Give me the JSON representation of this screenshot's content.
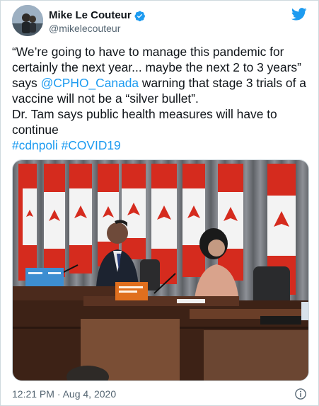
{
  "author": {
    "display_name": "Mike Le Couteur",
    "handle": "@mikelecouteur"
  },
  "tweet": {
    "line1": "“We’re going to have to manage this pandemic for certainly the next year... maybe the next 2 to 3 years” says ",
    "mention": "@CPHO_Canada",
    "line2": " warning that stage 3 trials of a vaccine will not be a “silver bullet”.\nDr. Tam says public health measures will have to continue\n",
    "hashtag1": "#cdnpoli",
    "hashtag2": "#COVID19"
  },
  "footer": {
    "timestamp": "12:21 PM · Aug 4, 2020"
  },
  "icons": {
    "verified": "verified-badge-icon",
    "brand": "twitter-bird-icon",
    "info": "info-icon"
  },
  "colors": {
    "accent": "#1d9bf0",
    "text": "#0f1419",
    "muted": "#536471",
    "flag_red": "#d52b1e"
  }
}
